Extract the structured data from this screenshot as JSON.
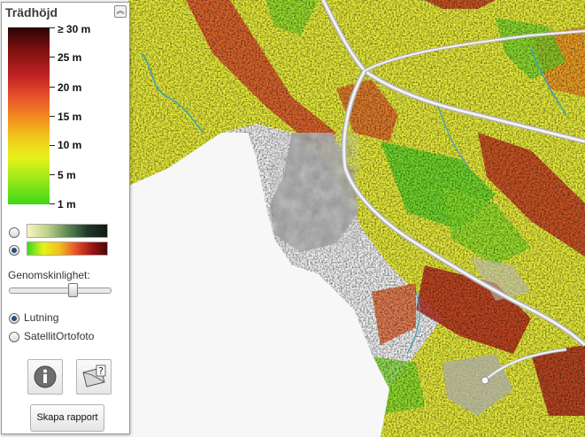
{
  "panel": {
    "title": "Trädhöjd",
    "collapse_glyph": "︽"
  },
  "legend": {
    "labels": [
      "≥ 30 m",
      "25 m",
      "20 m",
      "15 m",
      "10 m",
      "5 m",
      "1 m"
    ]
  },
  "color_schemes": [
    {
      "name": "dark-green-ramp",
      "selected": false
    },
    {
      "name": "heat-ramp",
      "selected": true
    }
  ],
  "transparency": {
    "label": "Genomskinlighet:",
    "value": 0.65
  },
  "base_layers": [
    {
      "label": "Lutning",
      "selected": true
    },
    {
      "label": "SatellitOrtofoto",
      "selected": false
    }
  ],
  "buttons": {
    "info_icon": "info-icon",
    "help_icon": "help-card-icon",
    "report_label": "Skapa rapport"
  },
  "colors": {
    "accent": "#2b4f7a"
  }
}
